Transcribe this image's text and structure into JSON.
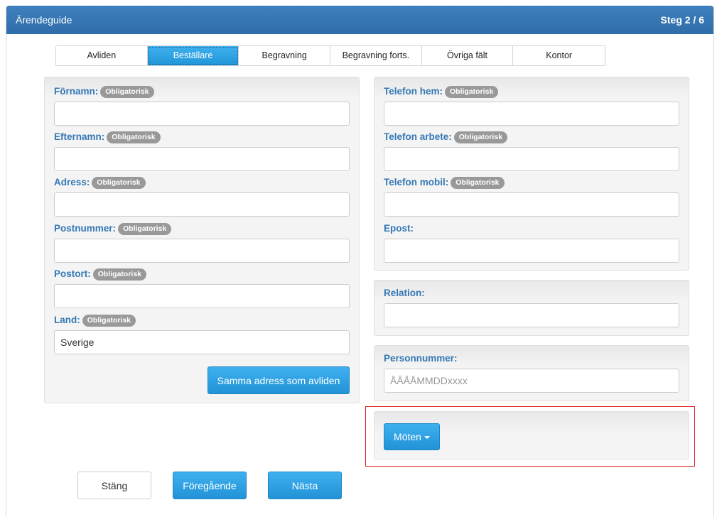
{
  "header": {
    "title": "Ärendeguide",
    "step": "Steg 2 / 6"
  },
  "tabs": [
    {
      "label": "Avliden",
      "active": false
    },
    {
      "label": "Beställare",
      "active": true
    },
    {
      "label": "Begravning",
      "active": false
    },
    {
      "label": "Begravning forts.",
      "active": false
    },
    {
      "label": "Övriga fält",
      "active": false
    },
    {
      "label": "Kontor",
      "active": false
    }
  ],
  "badge": "Obligatorisk",
  "left_form": {
    "fornamn": {
      "label": "Förnamn:",
      "value": ""
    },
    "efternamn": {
      "label": "Efternamn:",
      "value": ""
    },
    "adress": {
      "label": "Adress:",
      "value": ""
    },
    "postnummer": {
      "label": "Postnummer:",
      "value": ""
    },
    "postort": {
      "label": "Postort:",
      "value": ""
    },
    "land": {
      "label": "Land:",
      "value": "Sverige"
    },
    "same_address_button": "Samma adress som avliden"
  },
  "right_form": {
    "telefon_hem": {
      "label": "Telefon hem:",
      "value": ""
    },
    "telefon_arbete": {
      "label": "Telefon arbete:",
      "value": ""
    },
    "telefon_mobil": {
      "label": "Telefon mobil:",
      "value": ""
    },
    "epost": {
      "label": "Epost:",
      "value": ""
    }
  },
  "relation": {
    "label": "Relation:",
    "value": ""
  },
  "personnummer": {
    "label": "Personnummer:",
    "value": "",
    "placeholder": "ÅÅÅÅMMDDxxxx"
  },
  "moten": {
    "label": "Möten"
  },
  "footer": {
    "close": "Stäng",
    "previous": "Föregående",
    "next": "Nästa"
  }
}
